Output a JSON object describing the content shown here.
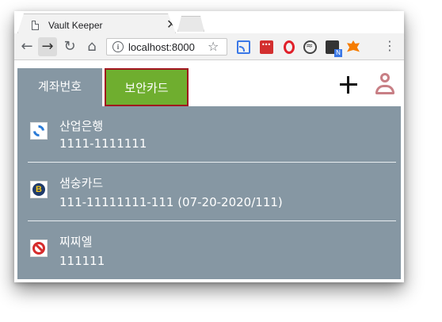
{
  "browser": {
    "tab_title": "Vault Keeper",
    "url": "localhost:8000",
    "icons": [
      "page-icon",
      "close-icon",
      "back-icon",
      "forward-icon",
      "reload-icon",
      "home-icon",
      "info-icon",
      "star-icon",
      "cast-icon",
      "menu-icon"
    ]
  },
  "app": {
    "tabs": [
      {
        "label": "계좌번호"
      },
      {
        "label": "보안카드"
      }
    ],
    "colors": {
      "tab_bg": "#8697a3",
      "active_tab": "#6fae2f",
      "active_border": "#a0141e",
      "list_bg": "#8697a3"
    },
    "items": [
      {
        "name": "산업은행",
        "number": "1111-1111111",
        "icon": "bank-logo-icon"
      },
      {
        "name": "샘숭카드",
        "number": "111-11111111-111 (07-20-2020/111)",
        "icon": "card-logo-icon"
      },
      {
        "name": "찌찌엘",
        "number": "111111",
        "icon": "no-entry-icon"
      }
    ]
  }
}
